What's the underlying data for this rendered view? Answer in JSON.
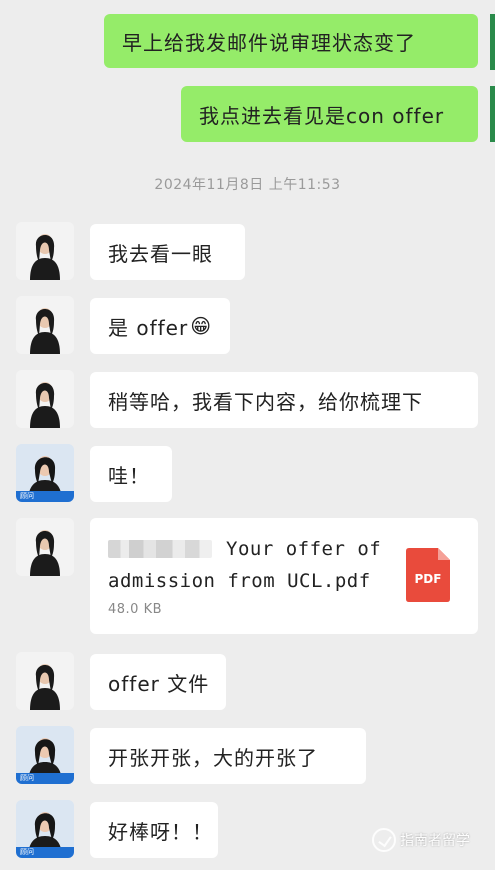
{
  "messages_out": [
    {
      "text": "早上给我发邮件说审理状态变了"
    },
    {
      "text": "我点进去看见是con offer"
    }
  ],
  "timestamp": "2024年11月8日 上午11:53",
  "messages_in": [
    {
      "text": "我去看一眼"
    },
    {
      "text": "是 offer",
      "emoji": "😁"
    },
    {
      "text": "稍等哈，我看下内容，给你梳理下"
    },
    {
      "text": "哇！"
    },
    {
      "text": "offer 文件"
    },
    {
      "text": "开张开张，大的开张了"
    },
    {
      "text": "好棒呀！！"
    }
  ],
  "file": {
    "name_line1": "Your offer of",
    "name_line2": "admission from UCL.pdf",
    "size": "48.0 KB",
    "icon_label": "PDF",
    "icon_color": "#e94b3c"
  },
  "avatar_tag": "顾问",
  "watermark": {
    "text": "指南者留学",
    "icon": "check-circle-icon"
  },
  "colors": {
    "background": "#ededed",
    "outgoing_bubble": "#95ec69",
    "incoming_bubble": "#ffffff",
    "pdf_red": "#e94b3c"
  }
}
